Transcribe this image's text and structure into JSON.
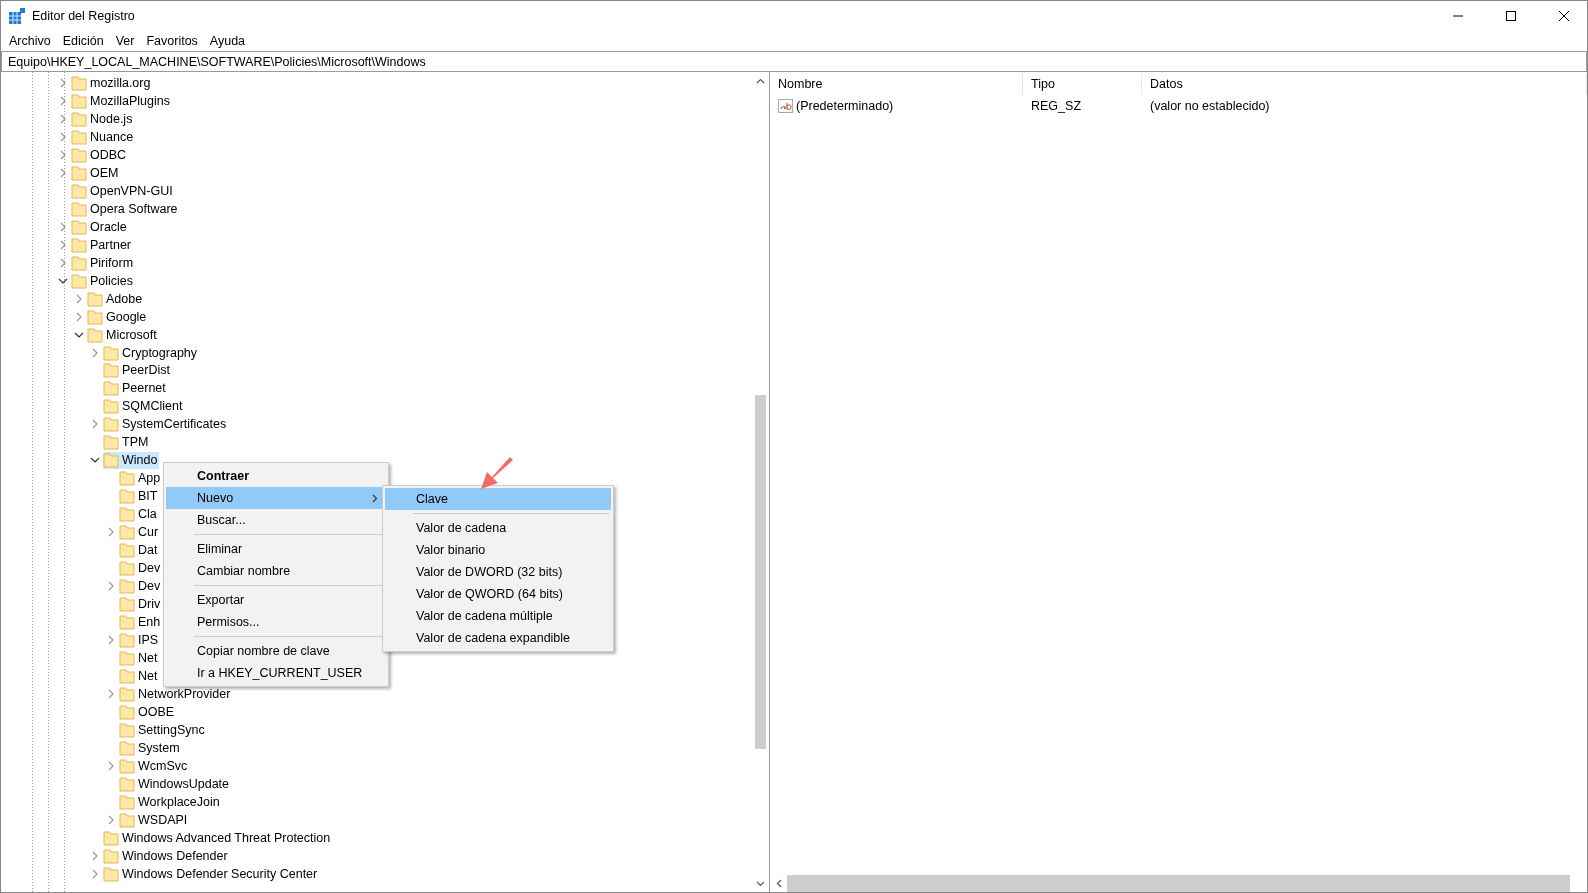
{
  "window": {
    "title": "Editor del Registro"
  },
  "menu_bar": [
    "Archivo",
    "Edición",
    "Ver",
    "Favoritos",
    "Ayuda"
  ],
  "address": "Equipo\\HKEY_LOCAL_MACHINE\\SOFTWARE\\Policies\\Microsoft\\Windows",
  "tree": [
    {
      "label": "mozilla.org",
      "expanded": false,
      "selected": false
    },
    {
      "label": "MozillaPlugins",
      "expanded": false,
      "selected": false
    },
    {
      "label": "Node.js",
      "expanded": false,
      "selected": false
    },
    {
      "label": "Nuance",
      "expanded": false,
      "selected": false
    },
    {
      "label": "ODBC",
      "expanded": false,
      "selected": false
    },
    {
      "label": "OEM",
      "expanded": false,
      "selected": false
    },
    {
      "label": "OpenVPN-GUI",
      "selected": false
    },
    {
      "label": "Opera Software",
      "selected": false
    },
    {
      "label": "Oracle",
      "expanded": false,
      "selected": false
    },
    {
      "label": "Partner",
      "expanded": false,
      "selected": false
    },
    {
      "label": "Piriform",
      "expanded": false,
      "selected": false
    },
    {
      "label": "Policies",
      "expanded": true,
      "selected": false,
      "children": [
        {
          "label": "Adobe",
          "expanded": false,
          "selected": false
        },
        {
          "label": "Google",
          "expanded": false,
          "selected": false
        },
        {
          "label": "Microsoft",
          "expanded": true,
          "selected": false,
          "children": [
            {
              "label": "Cryptography",
              "expanded": false,
              "selected": false
            },
            {
              "label": "PeerDist",
              "selected": false
            },
            {
              "label": "Peernet",
              "selected": false
            },
            {
              "label": "SQMClient",
              "selected": false
            },
            {
              "label": "SystemCertificates",
              "expanded": false,
              "selected": false
            },
            {
              "label": "TPM",
              "selected": false
            },
            {
              "label": "Windo",
              "expanded": true,
              "selected": true,
              "children": [
                {
                  "label": "App",
                  "selected": false
                },
                {
                  "label": "BIT",
                  "selected": false
                },
                {
                  "label": "Cla",
                  "selected": false
                },
                {
                  "label": "Cur",
                  "expanded": false,
                  "selected": false
                },
                {
                  "label": "Dat",
                  "selected": false
                },
                {
                  "label": "Dev",
                  "selected": false
                },
                {
                  "label": "Dev",
                  "expanded": false,
                  "selected": false
                },
                {
                  "label": "Driv",
                  "selected": false
                },
                {
                  "label": "Enh",
                  "selected": false
                },
                {
                  "label": "IPS",
                  "expanded": false,
                  "selected": false
                },
                {
                  "label": "Net",
                  "selected": false
                },
                {
                  "label": "Net",
                  "selected": false
                },
                {
                  "label": "NetworkProvider",
                  "expanded": false,
                  "selected": false
                },
                {
                  "label": "OOBE",
                  "selected": false
                },
                {
                  "label": "SettingSync",
                  "selected": false
                },
                {
                  "label": "System",
                  "selected": false
                },
                {
                  "label": "WcmSvc",
                  "expanded": false,
                  "selected": false
                },
                {
                  "label": "WindowsUpdate",
                  "selected": false
                },
                {
                  "label": "WorkplaceJoin",
                  "selected": false
                },
                {
                  "label": "WSDAPI",
                  "expanded": false,
                  "selected": false
                }
              ]
            },
            {
              "label": "Windows Advanced Threat Protection",
              "selected": false
            },
            {
              "label": "Windows Defender",
              "expanded": false,
              "selected": false
            },
            {
              "label": "Windows Defender Security Center",
              "expanded": false,
              "selected": false
            }
          ]
        }
      ]
    }
  ],
  "values": {
    "columns": [
      "Nombre",
      "Tipo",
      "Datos"
    ],
    "rows": [
      {
        "name": "(Predeterminado)",
        "type": "REG_SZ",
        "data": "(valor no establecido)"
      }
    ]
  },
  "context_menu": {
    "groups": [
      [
        {
          "label": "Contraer",
          "bold": true,
          "submenu": false,
          "selected": false
        },
        {
          "label": "Nuevo",
          "bold": false,
          "submenu": true,
          "selected": true
        },
        {
          "label": "Buscar...",
          "bold": false,
          "submenu": false,
          "selected": false
        }
      ],
      [
        {
          "label": "Eliminar",
          "bold": false,
          "submenu": false,
          "selected": false
        },
        {
          "label": "Cambiar nombre",
          "bold": false,
          "submenu": false,
          "selected": false
        }
      ],
      [
        {
          "label": "Exportar",
          "bold": false,
          "submenu": false,
          "selected": false
        },
        {
          "label": "Permisos...",
          "bold": false,
          "submenu": false,
          "selected": false
        }
      ],
      [
        {
          "label": "Copiar nombre de clave",
          "bold": false,
          "submenu": false,
          "selected": false
        },
        {
          "label": "Ir a HKEY_CURRENT_USER",
          "bold": false,
          "submenu": false,
          "selected": false
        }
      ]
    ]
  },
  "submenu": {
    "groups": [
      [
        {
          "label": "Clave",
          "selected": true
        }
      ],
      [
        {
          "label": "Valor de cadena",
          "selected": false
        },
        {
          "label": "Valor binario",
          "selected": false
        },
        {
          "label": "Valor de DWORD (32 bits)",
          "selected": false
        },
        {
          "label": "Valor de QWORD (64 bits)",
          "selected": false
        },
        {
          "label": "Valor de cadena múltiple",
          "selected": false
        },
        {
          "label": "Valor de cadena expandible",
          "selected": false
        }
      ]
    ]
  }
}
